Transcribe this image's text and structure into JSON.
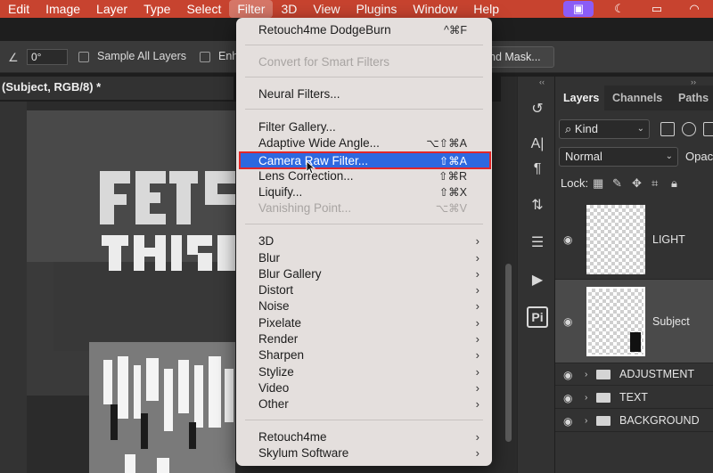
{
  "menubar": {
    "items": [
      "Edit",
      "Image",
      "Layer",
      "Type",
      "Select",
      "Filter",
      "3D",
      "View",
      "Plugins",
      "Window",
      "Help"
    ],
    "active": "Filter"
  },
  "options": {
    "angle_value": "0°",
    "sample_all_layers": "Sample All Layers",
    "enhance_partial": "Enh",
    "mask_button": "nd Mask..."
  },
  "document": {
    "tab_title": "(Subject, RGB/8) *"
  },
  "layers_panel": {
    "tabs": [
      "Layers",
      "Channels",
      "Paths"
    ],
    "kind_filter": "Kind",
    "blend_mode": "Normal",
    "opacity_label": "Opaci",
    "lock_label": "Lock:",
    "layers": [
      {
        "name": "LIGHT"
      },
      {
        "name": "Subject"
      }
    ],
    "groups": [
      {
        "name": "ADJUSTMENT"
      },
      {
        "name": "TEXT"
      },
      {
        "name": "BACKGROUND"
      }
    ]
  },
  "filter_menu": {
    "retouch_dodgeburn": {
      "label": "Retouch4me DodgeBurn",
      "shortcut": "^⌘F"
    },
    "convert_smart": {
      "label": "Convert for Smart Filters"
    },
    "neural_filters": {
      "label": "Neural Filters..."
    },
    "filter_gallery": {
      "label": "Filter Gallery..."
    },
    "adaptive_wide": {
      "label": "Adaptive Wide Angle...",
      "shortcut": "⌥⇧⌘A"
    },
    "camera_raw": {
      "label": "Camera Raw Filter...",
      "shortcut": "⇧⌘A"
    },
    "lens_correction": {
      "label": "Lens Correction...",
      "shortcut": "⇧⌘R"
    },
    "liquify": {
      "label": "Liquify...",
      "shortcut": "⇧⌘X"
    },
    "vanishing_point": {
      "label": "Vanishing Point...",
      "shortcut": "⌥⌘V"
    },
    "submenus": [
      "3D",
      "Blur",
      "Blur Gallery",
      "Distort",
      "Noise",
      "Pixelate",
      "Render",
      "Sharpen",
      "Stylize",
      "Video",
      "Other"
    ],
    "plugins": [
      "Retouch4me",
      "Skylum Software"
    ]
  },
  "colors": {
    "menubar": "#c7432f",
    "highlight": "#2d68e0",
    "highlight_border": "#e0262a",
    "menu_bg": "#e4dfdd"
  }
}
